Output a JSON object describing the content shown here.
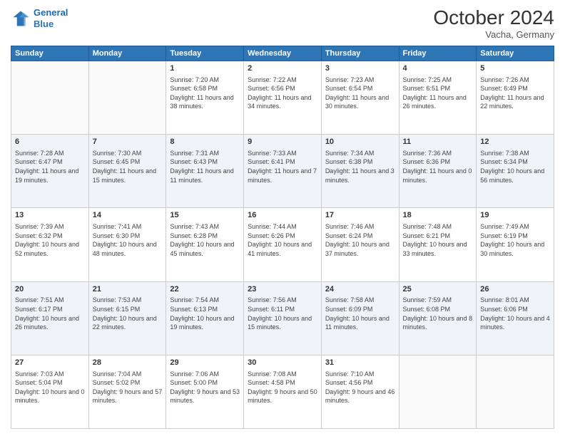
{
  "header": {
    "logo_line1": "General",
    "logo_line2": "Blue",
    "month_title": "October 2024",
    "location": "Vacha, Germany"
  },
  "weekdays": [
    "Sunday",
    "Monday",
    "Tuesday",
    "Wednesday",
    "Thursday",
    "Friday",
    "Saturday"
  ],
  "weeks": [
    [
      {
        "day": "",
        "empty": true
      },
      {
        "day": "",
        "empty": true
      },
      {
        "day": "1",
        "sunrise": "7:20 AM",
        "sunset": "6:58 PM",
        "daylight": "11 hours and 38 minutes."
      },
      {
        "day": "2",
        "sunrise": "7:22 AM",
        "sunset": "6:56 PM",
        "daylight": "11 hours and 34 minutes."
      },
      {
        "day": "3",
        "sunrise": "7:23 AM",
        "sunset": "6:54 PM",
        "daylight": "11 hours and 30 minutes."
      },
      {
        "day": "4",
        "sunrise": "7:25 AM",
        "sunset": "6:51 PM",
        "daylight": "11 hours and 26 minutes."
      },
      {
        "day": "5",
        "sunrise": "7:26 AM",
        "sunset": "6:49 PM",
        "daylight": "11 hours and 22 minutes."
      }
    ],
    [
      {
        "day": "6",
        "sunrise": "7:28 AM",
        "sunset": "6:47 PM",
        "daylight": "11 hours and 19 minutes."
      },
      {
        "day": "7",
        "sunrise": "7:30 AM",
        "sunset": "6:45 PM",
        "daylight": "11 hours and 15 minutes."
      },
      {
        "day": "8",
        "sunrise": "7:31 AM",
        "sunset": "6:43 PM",
        "daylight": "11 hours and 11 minutes."
      },
      {
        "day": "9",
        "sunrise": "7:33 AM",
        "sunset": "6:41 PM",
        "daylight": "11 hours and 7 minutes."
      },
      {
        "day": "10",
        "sunrise": "7:34 AM",
        "sunset": "6:38 PM",
        "daylight": "11 hours and 3 minutes."
      },
      {
        "day": "11",
        "sunrise": "7:36 AM",
        "sunset": "6:36 PM",
        "daylight": "11 hours and 0 minutes."
      },
      {
        "day": "12",
        "sunrise": "7:38 AM",
        "sunset": "6:34 PM",
        "daylight": "10 hours and 56 minutes."
      }
    ],
    [
      {
        "day": "13",
        "sunrise": "7:39 AM",
        "sunset": "6:32 PM",
        "daylight": "10 hours and 52 minutes."
      },
      {
        "day": "14",
        "sunrise": "7:41 AM",
        "sunset": "6:30 PM",
        "daylight": "10 hours and 48 minutes."
      },
      {
        "day": "15",
        "sunrise": "7:43 AM",
        "sunset": "6:28 PM",
        "daylight": "10 hours and 45 minutes."
      },
      {
        "day": "16",
        "sunrise": "7:44 AM",
        "sunset": "6:26 PM",
        "daylight": "10 hours and 41 minutes."
      },
      {
        "day": "17",
        "sunrise": "7:46 AM",
        "sunset": "6:24 PM",
        "daylight": "10 hours and 37 minutes."
      },
      {
        "day": "18",
        "sunrise": "7:48 AM",
        "sunset": "6:21 PM",
        "daylight": "10 hours and 33 minutes."
      },
      {
        "day": "19",
        "sunrise": "7:49 AM",
        "sunset": "6:19 PM",
        "daylight": "10 hours and 30 minutes."
      }
    ],
    [
      {
        "day": "20",
        "sunrise": "7:51 AM",
        "sunset": "6:17 PM",
        "daylight": "10 hours and 26 minutes."
      },
      {
        "day": "21",
        "sunrise": "7:53 AM",
        "sunset": "6:15 PM",
        "daylight": "10 hours and 22 minutes."
      },
      {
        "day": "22",
        "sunrise": "7:54 AM",
        "sunset": "6:13 PM",
        "daylight": "10 hours and 19 minutes."
      },
      {
        "day": "23",
        "sunrise": "7:56 AM",
        "sunset": "6:11 PM",
        "daylight": "10 hours and 15 minutes."
      },
      {
        "day": "24",
        "sunrise": "7:58 AM",
        "sunset": "6:09 PM",
        "daylight": "10 hours and 11 minutes."
      },
      {
        "day": "25",
        "sunrise": "7:59 AM",
        "sunset": "6:08 PM",
        "daylight": "10 hours and 8 minutes."
      },
      {
        "day": "26",
        "sunrise": "8:01 AM",
        "sunset": "6:06 PM",
        "daylight": "10 hours and 4 minutes."
      }
    ],
    [
      {
        "day": "27",
        "sunrise": "7:03 AM",
        "sunset": "5:04 PM",
        "daylight": "10 hours and 0 minutes."
      },
      {
        "day": "28",
        "sunrise": "7:04 AM",
        "sunset": "5:02 PM",
        "daylight": "9 hours and 57 minutes."
      },
      {
        "day": "29",
        "sunrise": "7:06 AM",
        "sunset": "5:00 PM",
        "daylight": "9 hours and 53 minutes."
      },
      {
        "day": "30",
        "sunrise": "7:08 AM",
        "sunset": "4:58 PM",
        "daylight": "9 hours and 50 minutes."
      },
      {
        "day": "31",
        "sunrise": "7:10 AM",
        "sunset": "4:56 PM",
        "daylight": "9 hours and 46 minutes."
      },
      {
        "day": "",
        "empty": true
      },
      {
        "day": "",
        "empty": true
      }
    ]
  ]
}
